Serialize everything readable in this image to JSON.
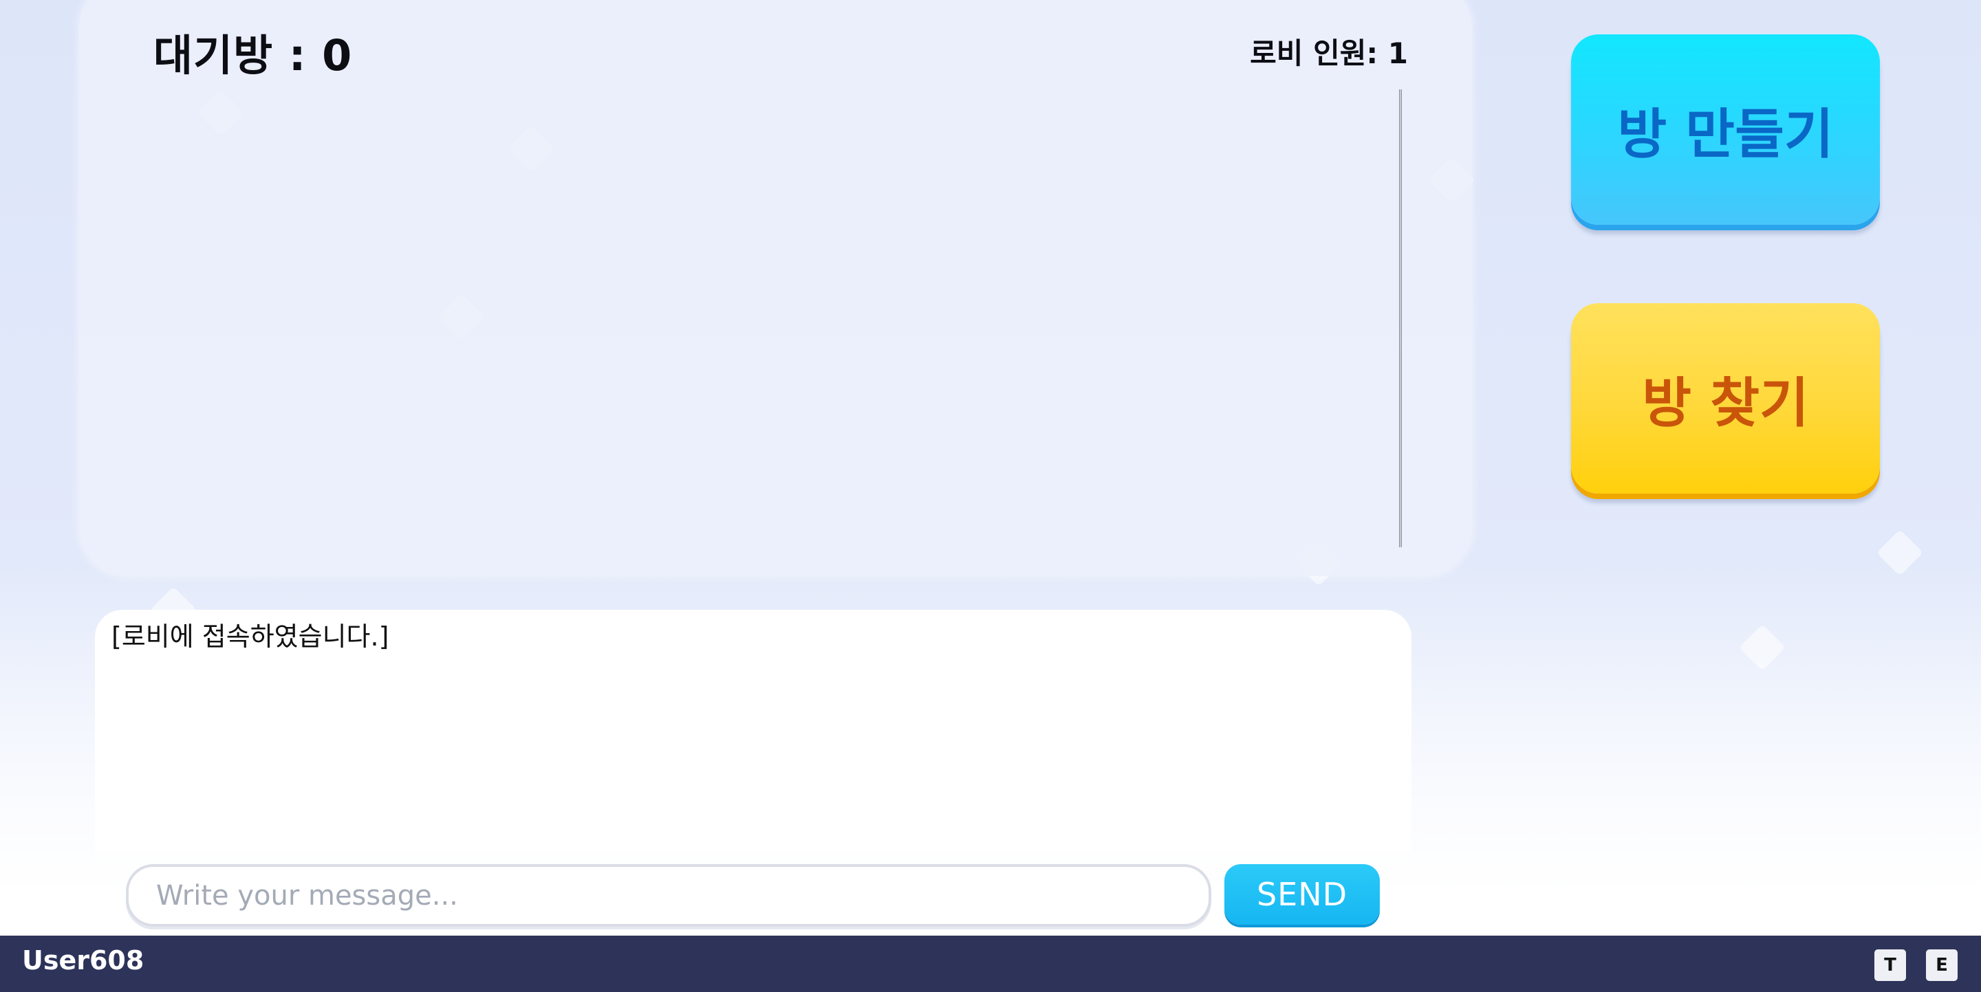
{
  "lobby": {
    "room_count_label": "대기방 : 0",
    "lobby_count_label": "로비 인원: 1"
  },
  "actions": {
    "create_room_label": "방 만들기",
    "find_room_label": "방 찾기"
  },
  "chat": {
    "messages": [
      "[로비에 접속하였습니다.]"
    ],
    "input_placeholder": "Write your message...",
    "input_value": "",
    "send_label": "SEND"
  },
  "footer": {
    "username": "User608",
    "buttons": [
      "T",
      "E"
    ]
  },
  "colors": {
    "create_button": "#2fd4ff",
    "create_text": "#0a67c6",
    "find_button": "#ffd83a",
    "find_text": "#c9550a",
    "send_button": "#16b6f2",
    "footer_bar": "#2d3359",
    "background": "#dde5f9"
  },
  "icons": {
    "background_decorations": "diamond-sparkle"
  }
}
